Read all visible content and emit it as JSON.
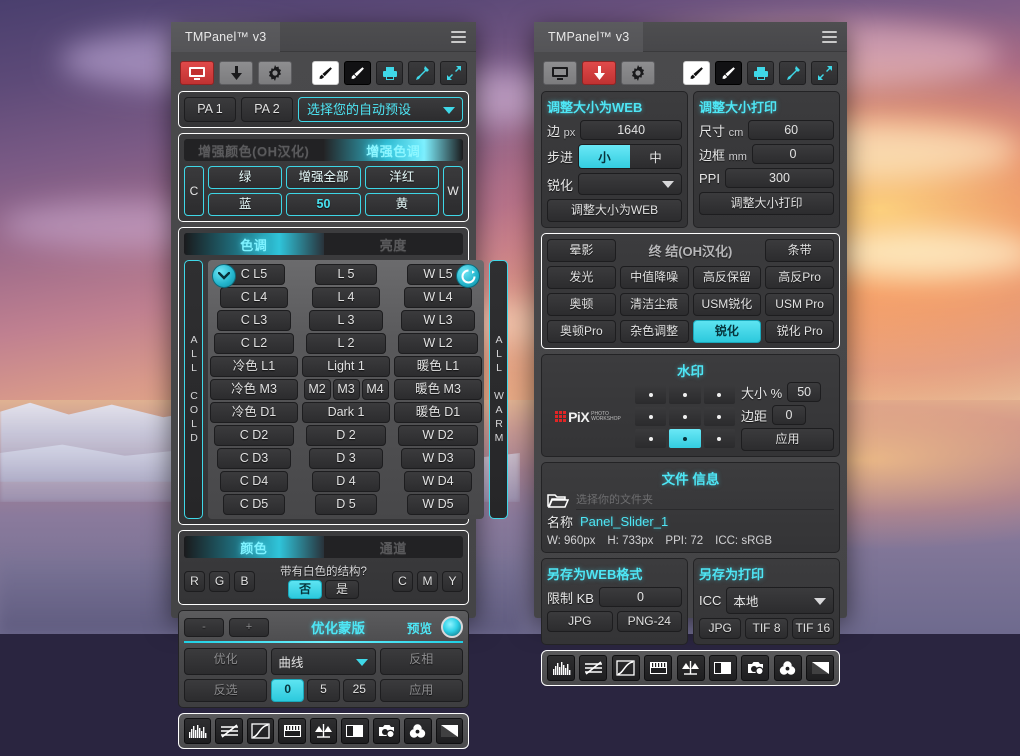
{
  "window": {
    "left_title": "TMPanel™ v3",
    "right_title": "TMPanel™ v3"
  },
  "left_panel": {
    "toolbar": {
      "icons": [
        "monitor-icon",
        "download-icon",
        "gear-icon",
        "brush-white-icon",
        "brush-black-icon",
        "printer-icon",
        "eyedropper-icon",
        "expand-icon"
      ]
    },
    "presets": {
      "pa1": "PA 1",
      "pa2": "PA 2",
      "dropdown_value": "选择您的自动预设"
    },
    "enhance_tabs": {
      "inactive": "增强颜色(OH汉化)",
      "active": "增强色调"
    },
    "enhance_colors": {
      "left_side": "C",
      "right_side": "W",
      "buttons": [
        "绿",
        "增强全部",
        "洋红",
        "蓝",
        "50",
        "黄"
      ]
    },
    "tone_tabs": {
      "active": "色调",
      "inactive": "亮度"
    },
    "tone_matrix": {
      "left_label": "ALL COLD",
      "right_label": "ALL WARM",
      "rows": [
        [
          "C L5",
          "L 5",
          "W L5"
        ],
        [
          "C L4",
          "L 4",
          "W L4"
        ],
        [
          "C L3",
          "L 3",
          "W L3"
        ],
        [
          "C L2",
          "L 2",
          "W L2"
        ],
        [
          "冷色 L1",
          "Light 1",
          "暖色 L1"
        ],
        [
          "冷色 M3",
          "M-GROUP",
          "暖色 M3"
        ],
        [
          "冷色 D1",
          "Dark 1",
          "暖色 D1"
        ],
        [
          "C D2",
          "D 2",
          "W D2"
        ],
        [
          "C D3",
          "D 3",
          "W D3"
        ],
        [
          "C D4",
          "D 4",
          "W D4"
        ],
        [
          "C D5",
          "D 5",
          "W D5"
        ]
      ],
      "m_group": [
        "M2",
        "M3",
        "M4"
      ]
    },
    "color_section": {
      "tab_active": "颜色",
      "tab_inactive": "通道",
      "rgb": [
        "R",
        "G",
        "B"
      ],
      "question": "带有白色的结构?",
      "answer_no": "否",
      "answer_yes": "是",
      "cmy": [
        "C",
        "M",
        "Y"
      ]
    },
    "optimize_mask": {
      "minus": "-",
      "plus": "+",
      "title": "优化蒙版",
      "preview": "预览",
      "optimize": "优化",
      "curve_dropdown": "曲线",
      "invert": "反相",
      "deselect": "反选",
      "values": [
        "0",
        "5",
        "25"
      ],
      "apply": "应用"
    }
  },
  "right_panel": {
    "resize_web": {
      "title": "调整大小为WEB",
      "side_label": "边",
      "side_unit": "px",
      "side_value": "1640",
      "step_label": "步进",
      "step_small": "小",
      "step_medium": "中",
      "sharpen_label": "锐化",
      "sharpen_value": "",
      "action": "调整大小为WEB"
    },
    "resize_print": {
      "title": "调整大小打印",
      "size_label": "尺寸",
      "size_unit": "cm",
      "size_value": "60",
      "border_label": "边框",
      "border_unit": "mm",
      "border_value": "0",
      "ppi_label": "PPI",
      "ppi_value": "300",
      "action": "调整大小打印"
    },
    "effects": {
      "title": "终 结(OH汉化)",
      "buttons": [
        "晕影",
        "条带",
        "发光",
        "中值降噪",
        "高反保留",
        "高反Pro",
        "奥顿",
        "清洁尘痕",
        "USM锐化",
        "USM Pro",
        "奥顿Pro",
        "杂色调整",
        "锐化",
        "锐化 Pro"
      ]
    },
    "watermark": {
      "title": "水印",
      "logo": "PiX",
      "size_label": "大小 %",
      "size_value": "50",
      "margin_label": "边距",
      "margin_value": "0",
      "apply": "应用",
      "position_selected": 7
    },
    "file_info": {
      "title_a": "文件",
      "title_b": "信息",
      "folder_placeholder": "选择你的文件夹",
      "name_label": "名称",
      "name_value": "Panel_Slider_1",
      "meta": [
        "W: 960px",
        "H: 733px",
        "PPI: 72",
        "ICC: sRGB"
      ]
    },
    "save_web": {
      "title": "另存为WEB格式",
      "limit_label": "限制 KB",
      "limit_value": "0",
      "buttons": [
        "JPG",
        "PNG-24"
      ]
    },
    "save_print": {
      "title": "另存为打印",
      "icc_label": "ICC",
      "icc_value": "本地",
      "buttons": [
        "JPG",
        "TIF 8",
        "TIF 16"
      ]
    }
  },
  "adjustment_bar": {
    "icons": [
      "histogram-icon",
      "levels-icon",
      "curves-icon",
      "exposure-icon",
      "balance-icon",
      "black-white-icon",
      "photo-filter-icon",
      "channel-mixer-icon",
      "gradient-map-icon"
    ]
  },
  "colors": {
    "cyan": "#4ee6f5",
    "red": "#e04a4a",
    "panel_bg": "#444446"
  }
}
